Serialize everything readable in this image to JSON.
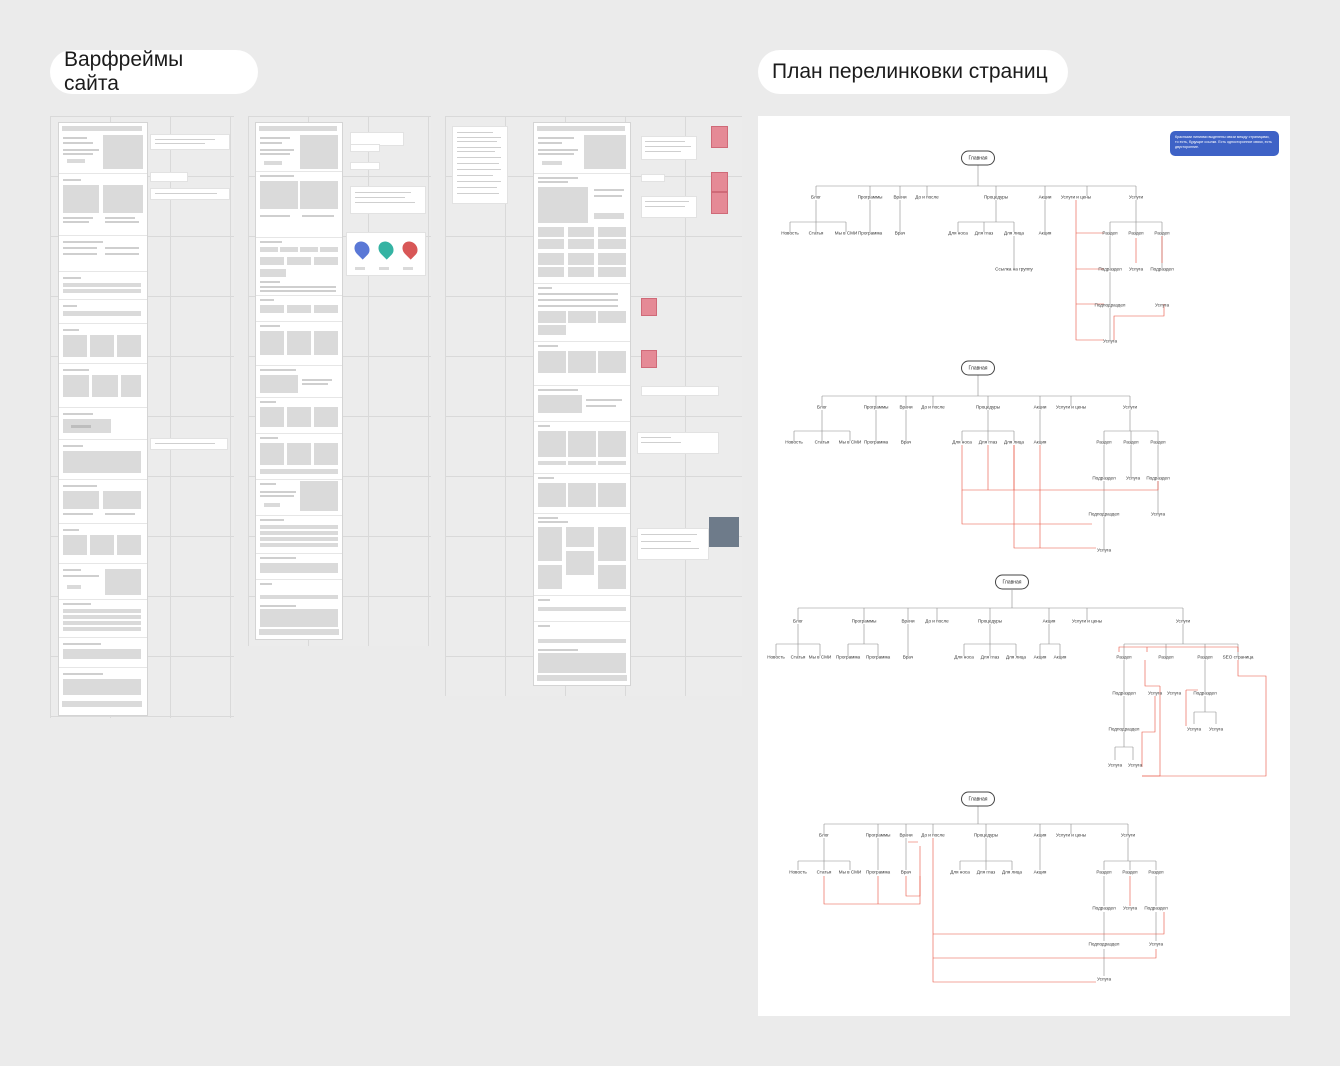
{
  "headings": {
    "wireframes": "Варфреймы сайта",
    "linking_plan": "План перелинковки страниц"
  },
  "legend": {
    "text": "Красными линиями выделены связи между страницами, то есть, будущие ссылки. Есть односторонние связи, есть двусторонние."
  },
  "colors": {
    "background": "#ebebeb",
    "legend_blue": "#3e62c6",
    "link_red": "#e8513f",
    "tree_line": "#8c8c8c",
    "sticky_pink": "#e58a96"
  },
  "tree1": {
    "root": "Главная",
    "sections": [
      "Блог",
      "Программы",
      "Врачи",
      "До и после",
      "Процедуры",
      "Акции",
      "Услуги и цены",
      "Услуги"
    ],
    "blog_children": [
      "Новость",
      "Статья",
      "Мы в СМИ"
    ],
    "programs_child": "Программа",
    "doctors_child": "Врач",
    "procedures_children": [
      "Для носа",
      "Для глаз",
      "Для лица"
    ],
    "procedures_extra": "Ссылка на группу",
    "actions_child": "Акция",
    "services_level1": [
      "Раздел",
      "Раздел",
      "Раздел"
    ],
    "services_level2": [
      "Подраздел",
      "Услуга",
      "Подраздел"
    ],
    "services_level3": [
      "Подподраздел",
      "Услуга"
    ],
    "services_level4": "Услуга"
  },
  "tree2": {
    "root": "Главная",
    "sections": [
      "Блог",
      "Программы",
      "Врачи",
      "До и после",
      "Процедуры",
      "Акции",
      "Услуги и цены",
      "Услуги"
    ],
    "blog_children": [
      "Новость",
      "Статья",
      "Мы в СМИ"
    ],
    "programs_child": "Программа",
    "doctors_child": "Врач",
    "procedures_children": [
      "Для носа",
      "Для глаз",
      "Для лица"
    ],
    "actions_child": "Акция",
    "services_level1": [
      "Раздел",
      "Раздел",
      "Раздел"
    ],
    "services_level2": [
      "Подраздел",
      "Услуга",
      "Подраздел"
    ],
    "services_level3": [
      "Подподраздел",
      "Услуга"
    ],
    "services_level4": "Услуга"
  },
  "tree3": {
    "root": "Главная",
    "sections": [
      "Блог",
      "Программы",
      "Врачи",
      "До и после",
      "Процедуры",
      "Акция",
      "Услуги и цены",
      "Услуги"
    ],
    "blog_children": [
      "Новость",
      "Статья",
      "Мы в СМИ"
    ],
    "programs_children": [
      "Программа",
      "Программа"
    ],
    "doctors_child": "Врач",
    "procedures_children": [
      "Для носа",
      "Для глаз",
      "Для лица"
    ],
    "actions_children": [
      "Акция",
      "Акция"
    ],
    "services_level1": [
      "Раздел",
      "Раздел",
      "Раздел",
      "SEO страница"
    ],
    "services_level2": [
      "Подраздел",
      "Услуга",
      "Услуга",
      "Подраздел"
    ],
    "services_level3": [
      "Подподраздел",
      "Услуга",
      "Услуга"
    ],
    "services_level4": [
      "Услуга",
      "Услуга"
    ]
  },
  "tree4": {
    "root": "Главная",
    "sections": [
      "Блог",
      "Программы",
      "Врачи",
      "До и после",
      "Процедуры",
      "Акция",
      "Услуги и цены",
      "Услуги"
    ],
    "blog_children": [
      "Новость",
      "Статья",
      "Мы в СМИ"
    ],
    "programs_child": "Программа",
    "doctors_child": "Врач",
    "procedures_children": [
      "Для носа",
      "Для глаз",
      "Для лица"
    ],
    "actions_child": "Акция",
    "services_level1": [
      "Раздел",
      "Раздел",
      "Раздел"
    ],
    "services_level2": [
      "Подраздел",
      "Услуга",
      "Подраздел"
    ],
    "services_level3": [
      "Подподраздел",
      "Услуга"
    ],
    "services_level4": "Услуга"
  }
}
